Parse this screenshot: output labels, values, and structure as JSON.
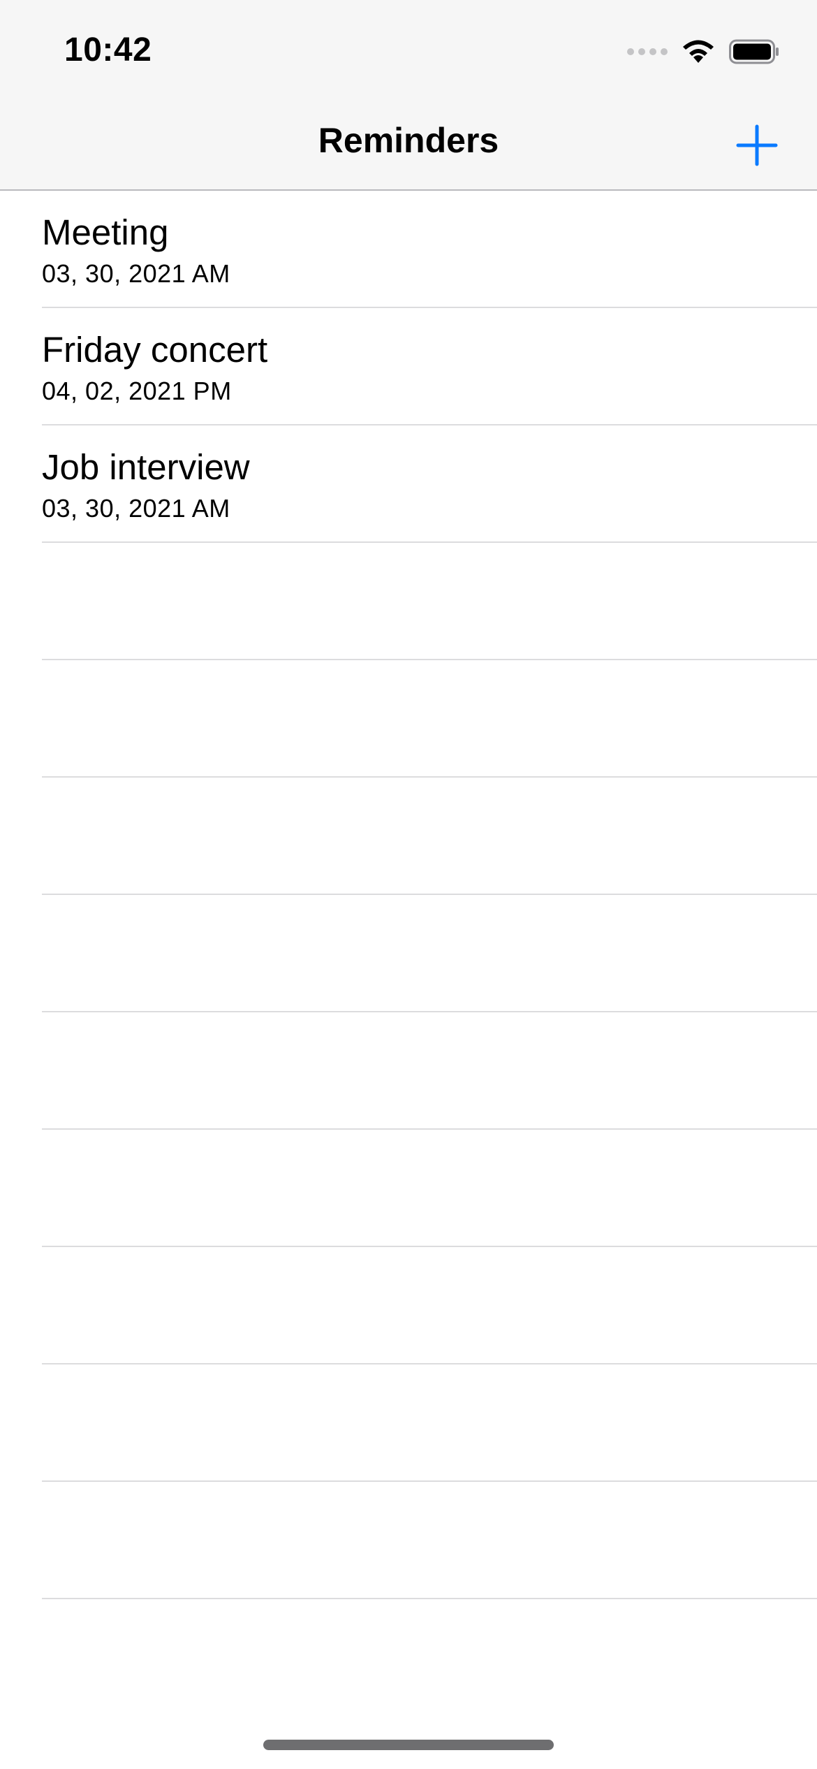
{
  "status_bar": {
    "time": "10:42"
  },
  "nav": {
    "title": "Reminders",
    "add_icon": "plus-icon"
  },
  "colors": {
    "accent": "#0a7aff",
    "chrome_bg": "#f6f6f6",
    "separator": "#dcdcde"
  },
  "reminders": [
    {
      "title": "Meeting",
      "date": "03, 30, 2021 AM"
    },
    {
      "title": "Friday concert",
      "date": "04, 02, 2021 PM"
    },
    {
      "title": "Job interview",
      "date": "03, 30, 2021 AM"
    },
    {
      "title": "",
      "date": ""
    },
    {
      "title": "",
      "date": ""
    },
    {
      "title": "",
      "date": ""
    },
    {
      "title": "",
      "date": ""
    },
    {
      "title": "",
      "date": ""
    },
    {
      "title": "",
      "date": ""
    },
    {
      "title": "",
      "date": ""
    },
    {
      "title": "",
      "date": ""
    },
    {
      "title": "",
      "date": ""
    }
  ]
}
